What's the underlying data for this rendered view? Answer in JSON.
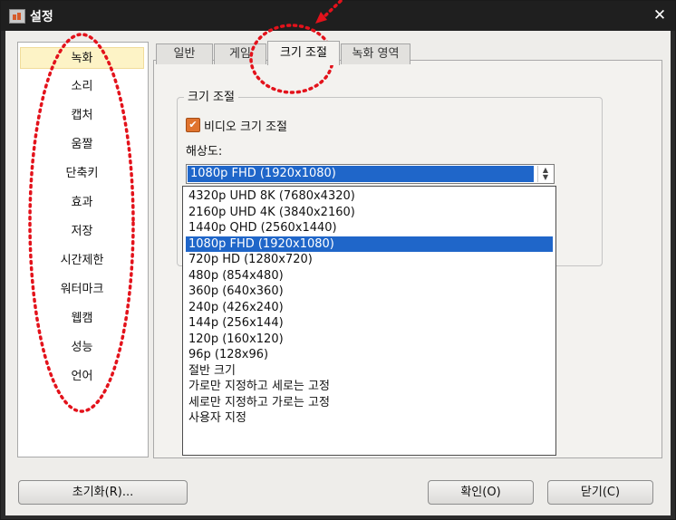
{
  "window": {
    "title": "설정",
    "close_glyph": "✕"
  },
  "sidebar": {
    "items": [
      "녹화",
      "소리",
      "캡처",
      "움짤",
      "단축키",
      "효과",
      "저장",
      "시간제한",
      "워터마크",
      "웹캠",
      "성능",
      "언어"
    ],
    "selected": "녹화"
  },
  "tabs": [
    "일반",
    "게임",
    "크기 조절",
    "녹화 영역"
  ],
  "active_tab": "크기 조절",
  "panel": {
    "group_title": "크기 조절",
    "checkbox": {
      "label": "비디오 크기 조절",
      "checked": true,
      "check_glyph": "✔"
    },
    "resolution_label": "해상도:",
    "select_value": "1080p FHD (1920x1080)",
    "spin_up_glyph": "▲",
    "spin_down_glyph": "▼",
    "options": [
      "4320p UHD 8K (7680x4320)",
      "2160p UHD 4K (3840x2160)",
      "1440p QHD (2560x1440)",
      "1080p FHD (1920x1080)",
      "720p HD (1280x720)",
      "480p (854x480)",
      "360p (640x360)",
      "240p (426x240)",
      "144p (256x144)",
      "120p (160x120)",
      "96p (128x96)",
      "절반 크기",
      "가로만 지정하고 세로는 고정",
      "세로만 지정하고 가로는 고정",
      "사용자 지정"
    ],
    "selected_option": "1080p FHD (1920x1080)"
  },
  "buttons": {
    "reset": "초기화(R)...",
    "ok": "확인(O)",
    "close": "닫기(C)"
  },
  "colors": {
    "selection": "#1f66c9",
    "annotation": "#e3121b",
    "checkbox": "#e0732e",
    "sidebar_selected": "#fdf3c6"
  },
  "icons": {
    "app": "app-icon",
    "close": "close-icon",
    "check": "check-icon",
    "spin": "spin-icon"
  }
}
